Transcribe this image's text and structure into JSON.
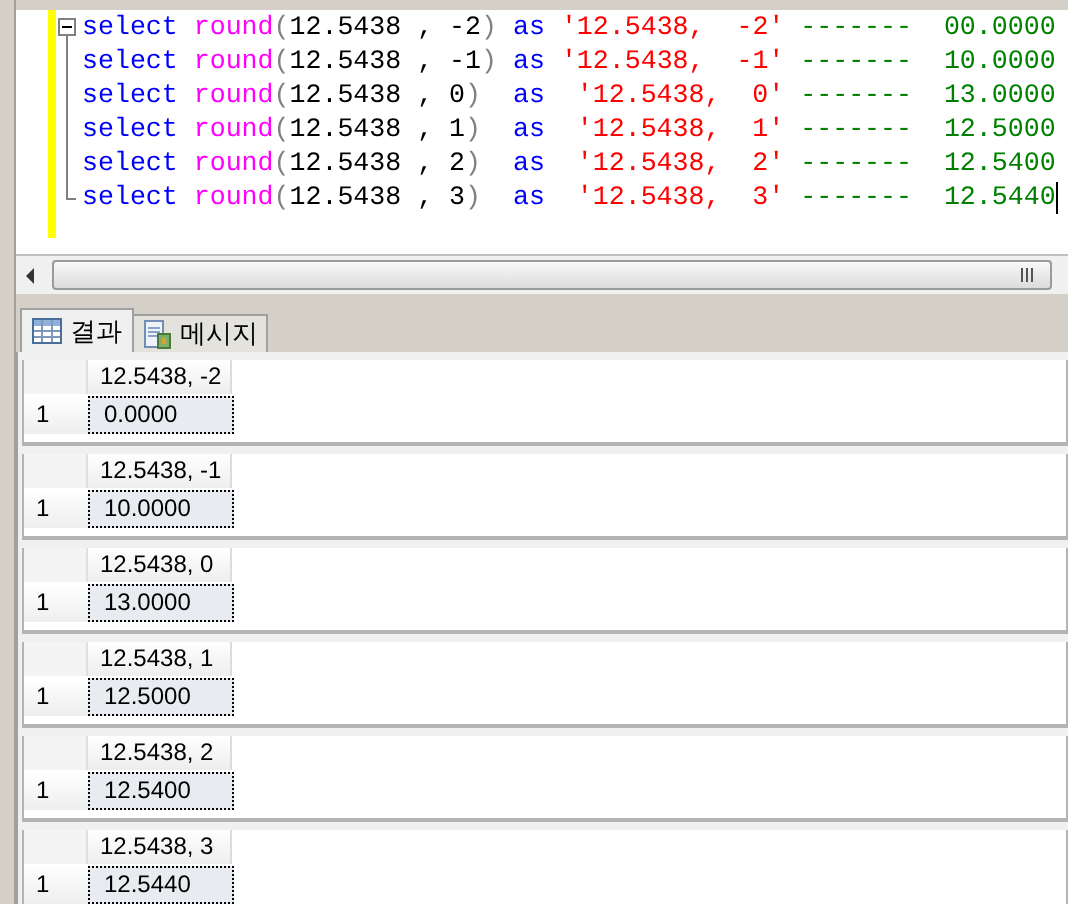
{
  "editor": {
    "lines": [
      {
        "tokens": [
          {
            "kind": "keyword",
            "text": "select "
          },
          {
            "kind": "function",
            "text": "round"
          },
          {
            "kind": "paren",
            "text": "("
          },
          {
            "kind": "plain",
            "text": "12.5438 , -2"
          },
          {
            "kind": "paren",
            "text": ") "
          },
          {
            "kind": "keyword",
            "text": "as "
          },
          {
            "kind": "string",
            "text": "'12.5438,  -2' "
          },
          {
            "kind": "comment",
            "text": "-------  00.0000"
          }
        ]
      },
      {
        "tokens": [
          {
            "kind": "keyword",
            "text": "select "
          },
          {
            "kind": "function",
            "text": "round"
          },
          {
            "kind": "paren",
            "text": "("
          },
          {
            "kind": "plain",
            "text": "12.5438 , -1"
          },
          {
            "kind": "paren",
            "text": ") "
          },
          {
            "kind": "keyword",
            "text": "as "
          },
          {
            "kind": "string",
            "text": "'12.5438,  -1' "
          },
          {
            "kind": "comment",
            "text": "-------  10.0000"
          }
        ]
      },
      {
        "tokens": [
          {
            "kind": "keyword",
            "text": "select "
          },
          {
            "kind": "function",
            "text": "round"
          },
          {
            "kind": "paren",
            "text": "("
          },
          {
            "kind": "plain",
            "text": "12.5438 , 0"
          },
          {
            "kind": "paren",
            "text": ")  "
          },
          {
            "kind": "keyword",
            "text": "as  "
          },
          {
            "kind": "string",
            "text": "'12.5438,  0' "
          },
          {
            "kind": "comment",
            "text": "-------  13.0000"
          }
        ]
      },
      {
        "tokens": [
          {
            "kind": "keyword",
            "text": "select "
          },
          {
            "kind": "function",
            "text": "round"
          },
          {
            "kind": "paren",
            "text": "("
          },
          {
            "kind": "plain",
            "text": "12.5438 , 1"
          },
          {
            "kind": "paren",
            "text": ")  "
          },
          {
            "kind": "keyword",
            "text": "as  "
          },
          {
            "kind": "string",
            "text": "'12.5438,  1' "
          },
          {
            "kind": "comment",
            "text": "-------  12.5000"
          }
        ]
      },
      {
        "tokens": [
          {
            "kind": "keyword",
            "text": "select "
          },
          {
            "kind": "function",
            "text": "round"
          },
          {
            "kind": "paren",
            "text": "("
          },
          {
            "kind": "plain",
            "text": "12.5438 , 2"
          },
          {
            "kind": "paren",
            "text": ")  "
          },
          {
            "kind": "keyword",
            "text": "as  "
          },
          {
            "kind": "string",
            "text": "'12.5438,  2' "
          },
          {
            "kind": "comment",
            "text": "-------  12.5400"
          }
        ]
      },
      {
        "tokens": [
          {
            "kind": "keyword",
            "text": "select "
          },
          {
            "kind": "function",
            "text": "round"
          },
          {
            "kind": "paren",
            "text": "("
          },
          {
            "kind": "plain",
            "text": "12.5438 , 3"
          },
          {
            "kind": "paren",
            "text": ")  "
          },
          {
            "kind": "keyword",
            "text": "as  "
          },
          {
            "kind": "string",
            "text": "'12.5438,  3' "
          },
          {
            "kind": "comment",
            "text": "-------  12.5440"
          }
        ]
      }
    ]
  },
  "result_tabs": [
    {
      "label": "결과",
      "selected": true,
      "kind": "grid"
    },
    {
      "label": "메시지",
      "selected": false,
      "kind": "messages"
    }
  ],
  "result_sets": [
    {
      "column": "12.5438, -2",
      "rows": [
        {
          "number": "1",
          "value": "0.0000",
          "selected": true
        }
      ]
    },
    {
      "column": "12.5438, -1",
      "rows": [
        {
          "number": "1",
          "value": "10.0000",
          "selected": true
        }
      ]
    },
    {
      "column": "12.5438, 0",
      "rows": [
        {
          "number": "1",
          "value": "13.0000",
          "selected": true
        }
      ]
    },
    {
      "column": "12.5438, 1",
      "rows": [
        {
          "number": "1",
          "value": "12.5000",
          "selected": true
        }
      ]
    },
    {
      "column": "12.5438, 2",
      "rows": [
        {
          "number": "1",
          "value": "12.5400",
          "selected": true
        }
      ]
    },
    {
      "column": "12.5438, 3",
      "rows": [
        {
          "number": "1",
          "value": "12.5440",
          "selected": true
        }
      ]
    }
  ]
}
